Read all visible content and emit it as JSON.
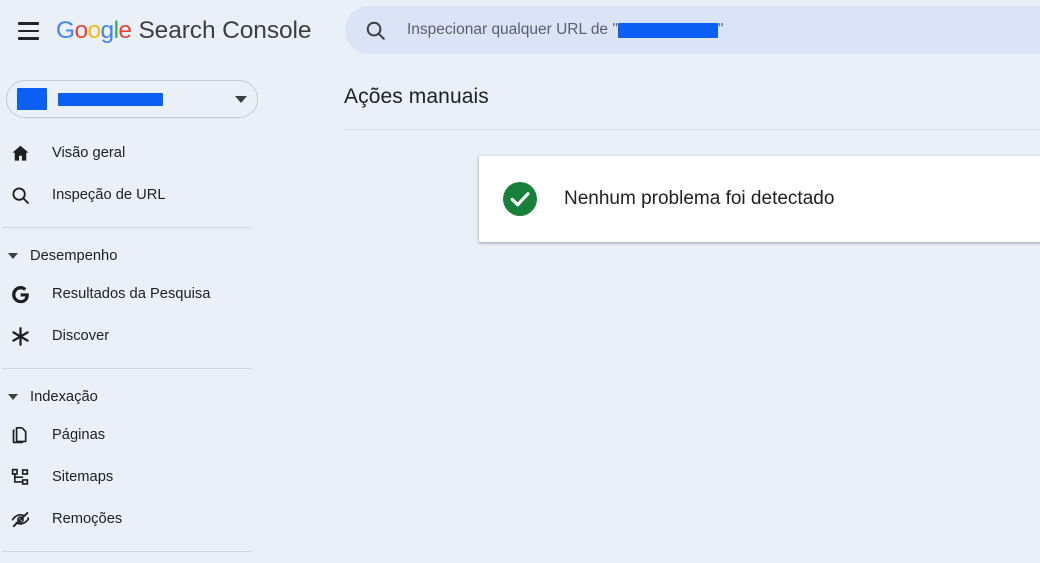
{
  "header": {
    "menu_icon": "hamburger-menu-icon",
    "logo_letters": [
      "G",
      "o",
      "o",
      "g",
      "l",
      "e"
    ],
    "product_name": "Search Console",
    "logo_colors": {
      "blue": "#4285F4",
      "red": "#EA4335",
      "yellow": "#FBBC05",
      "green": "#34A853"
    }
  },
  "search": {
    "icon": "search-icon",
    "placeholder_prefix": "Inspecionar qualquer URL de \"",
    "placeholder_suffix": "\"",
    "redacted": true,
    "redaction_color": "#0b5ff2"
  },
  "sidebar": {
    "property_selector": {
      "name": "property-selector",
      "redacted": true,
      "redaction_color": "#0b5ff2",
      "chevron_icon": "chevron-down-icon"
    },
    "items": [
      {
        "label": "Visão geral",
        "icon": "home-icon",
        "name": "sidebar-item-overview"
      },
      {
        "label": "Inspeção de URL",
        "icon": "search-icon",
        "name": "sidebar-item-url-inspection"
      }
    ],
    "groups": [
      {
        "label": "Desempenho",
        "name": "sidebar-group-performance",
        "caret_icon": "caret-down-icon",
        "items": [
          {
            "label": "Resultados da Pesquisa",
            "icon": "google-g-icon",
            "name": "sidebar-item-search-results"
          },
          {
            "label": "Discover",
            "icon": "asterisk-icon",
            "name": "sidebar-item-discover"
          }
        ]
      },
      {
        "label": "Indexação",
        "name": "sidebar-group-indexing",
        "caret_icon": "caret-down-icon",
        "items": [
          {
            "label": "Páginas",
            "icon": "pages-icon",
            "name": "sidebar-item-pages"
          },
          {
            "label": "Sitemaps",
            "icon": "sitemaps-icon",
            "name": "sidebar-item-sitemaps"
          },
          {
            "label": "Remoções",
            "icon": "eye-off-icon",
            "name": "sidebar-item-removals"
          }
        ]
      }
    ]
  },
  "main": {
    "title": "Ações manuais",
    "status_card": {
      "icon": "check-circle-icon",
      "icon_color": "#18803a",
      "message": "Nenhum problema foi detectado"
    }
  },
  "theme": {
    "page_background": "#eaf0f8",
    "search_pill_background": "#dbe3f6",
    "card_background": "#ffffff",
    "divider": "#d3dae6",
    "text_primary": "#202124",
    "text_secondary": "#5a6069"
  }
}
